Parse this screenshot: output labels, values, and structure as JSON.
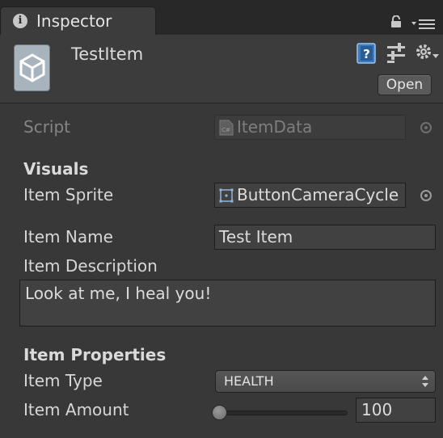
{
  "window": {
    "tab_title": "Inspector",
    "tab_icon": "info-icon"
  },
  "header": {
    "object_name": "TestItem",
    "open_label": "Open",
    "icons": [
      "help-book-icon",
      "presets-icon",
      "settings-gear-icon"
    ]
  },
  "fields": {
    "script_label": "Script",
    "script_value": "ItemData",
    "visuals_heading": "Visuals",
    "sprite_label": "Item Sprite",
    "sprite_value": "ButtonCameraCycle",
    "name_label": "Item Name",
    "name_value": "Test Item",
    "description_label": "Item Description",
    "description_value": "Look at me, I heal you!",
    "properties_heading": "Item Properties",
    "type_label": "Item Type",
    "type_value": "HEALTH",
    "amount_label": "Item Amount",
    "amount_value": "100",
    "amount_slider_fraction": 0
  },
  "colors": {
    "background": "#383838",
    "tabbar": "#282828",
    "field": "#414141"
  }
}
